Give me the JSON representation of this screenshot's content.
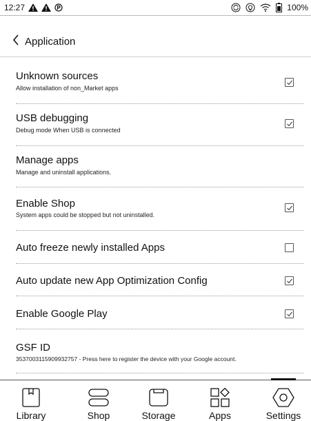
{
  "status_bar": {
    "time": "12:27",
    "battery": "100%",
    "icons": [
      "warning-icon",
      "warning-icon",
      "p-notification-icon",
      "sync-icon",
      "bulb-icon",
      "wifi-icon",
      "battery-icon"
    ]
  },
  "header": {
    "title": "Application",
    "back_icon": "chevron-left-icon"
  },
  "settings": [
    {
      "title": "Unknown sources",
      "subtitle": "Allow installation of non_Market apps",
      "checkbox": true,
      "checked": true
    },
    {
      "title": "USB debugging",
      "subtitle": "Debug mode When USB is connected",
      "checkbox": true,
      "checked": true
    },
    {
      "title": "Manage apps",
      "subtitle": "Manage and uninstall applications.",
      "checkbox": false,
      "checked": false
    },
    {
      "title": "Enable Shop",
      "subtitle": "System apps could be stopped but not uninstalled.",
      "checkbox": true,
      "checked": true
    },
    {
      "title": "Auto freeze newly installed Apps",
      "subtitle": "",
      "checkbox": true,
      "checked": false
    },
    {
      "title": "Auto update new App Optimization Config",
      "subtitle": "",
      "checkbox": true,
      "checked": true
    },
    {
      "title": "Enable Google Play",
      "subtitle": "",
      "checkbox": true,
      "checked": true
    },
    {
      "title": "GSF ID",
      "subtitle": "3537003115909932757 - Press here to register the device with your Google account.",
      "checkbox": false,
      "checked": false
    }
  ],
  "bottom_nav": [
    {
      "label": "Library",
      "icon": "library-icon"
    },
    {
      "label": "Shop",
      "icon": "shop-icon"
    },
    {
      "label": "Storage",
      "icon": "storage-icon"
    },
    {
      "label": "Apps",
      "icon": "apps-icon"
    },
    {
      "label": "Settings",
      "icon": "settings-icon",
      "active": true
    }
  ]
}
